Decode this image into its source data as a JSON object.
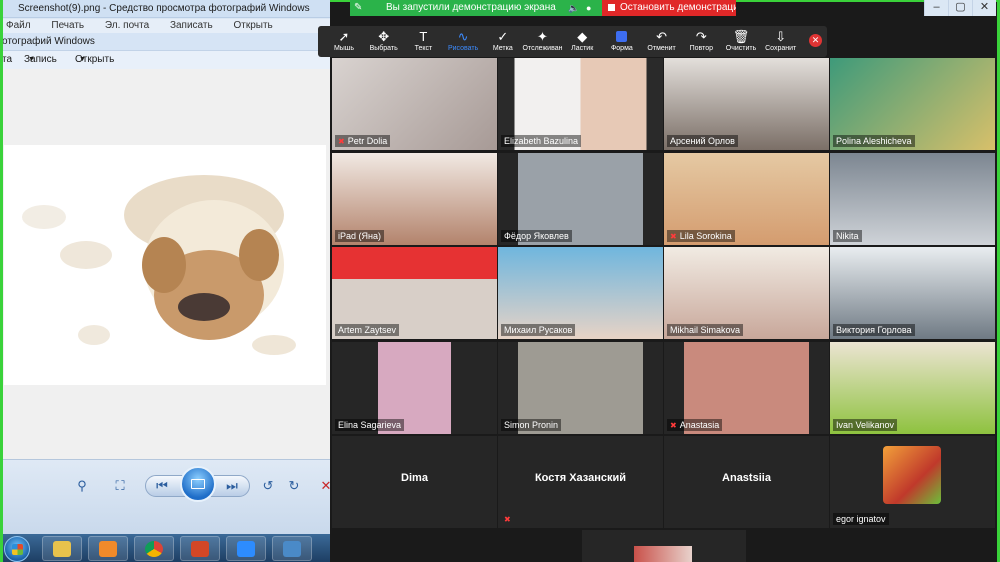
{
  "share_banner": {
    "status_text": "Вы запустили демонстрацию экрана",
    "stop_label": "Остановить демонстрацию"
  },
  "viewer": {
    "title": "Screenshot(9).png - Средство просмотра фотографий Windows",
    "menu_top": [
      "Файл",
      "Печать",
      "Эл. почта",
      "Записать",
      "Открыть"
    ],
    "inner_title": "отографий Windows",
    "menu": {
      "first": "та",
      "save": "Запись",
      "open": "Открыть"
    }
  },
  "toolbar": {
    "items": [
      {
        "label": "Мышь",
        "icon": "pointer-icon"
      },
      {
        "label": "Выбрать",
        "icon": "move-icon"
      },
      {
        "label": "Текст",
        "icon": "text-icon"
      },
      {
        "label": "Рисовать",
        "icon": "draw-icon"
      },
      {
        "label": "Метка",
        "icon": "check-icon"
      },
      {
        "label": "Отслеживан",
        "icon": "spotlight-icon"
      },
      {
        "label": "Ластик",
        "icon": "eraser-icon"
      },
      {
        "label": "Форма",
        "icon": "shape-icon"
      },
      {
        "label": "Отменит",
        "icon": "undo-icon"
      },
      {
        "label": "Повтор",
        "icon": "redo-icon"
      },
      {
        "label": "Очистить",
        "icon": "trash-icon"
      },
      {
        "label": "Сохранит",
        "icon": "save-icon"
      }
    ],
    "active_label": "Рисовать",
    "accent": "#3d8bfd"
  },
  "gallery": {
    "participants": [
      {
        "name": "Petr Dolia",
        "muted": true
      },
      {
        "name": "Elizabeth Bazulina",
        "muted": false
      },
      {
        "name": "Арсений Орлов",
        "muted": false
      },
      {
        "name": "Polina  Aleshicheva",
        "muted": false
      },
      {
        "name": "iPad (Яна)",
        "muted": false
      },
      {
        "name": "Фёдор Яковлев",
        "muted": false
      },
      {
        "name": "Lila Sorokina",
        "muted": true
      },
      {
        "name": "Nikita",
        "muted": false
      },
      {
        "name": "Artem Zaytsev",
        "muted": false
      },
      {
        "name": "Михаил Русаков",
        "muted": false
      },
      {
        "name": "Mikhail Simakova",
        "muted": false
      },
      {
        "name": "Виктория Горлова",
        "muted": false
      },
      {
        "name": "Elina Sagarieva",
        "muted": false
      },
      {
        "name": "Simon Pronin",
        "muted": false
      },
      {
        "name": "Anastasia",
        "muted": true
      },
      {
        "name": "Ivan Velikanov",
        "muted": false
      },
      {
        "name": "Dima",
        "muted": false
      },
      {
        "name": "Костя Хазанский",
        "muted": true
      },
      {
        "name": "Anastsiia",
        "muted": false
      },
      {
        "name": "egor ignatov",
        "muted": false
      }
    ]
  },
  "colors": {
    "share_green": "#2bb34a",
    "stop_red": "#e02828",
    "frame_green": "#3ad23a",
    "muted_red": "#ff3b3b"
  }
}
